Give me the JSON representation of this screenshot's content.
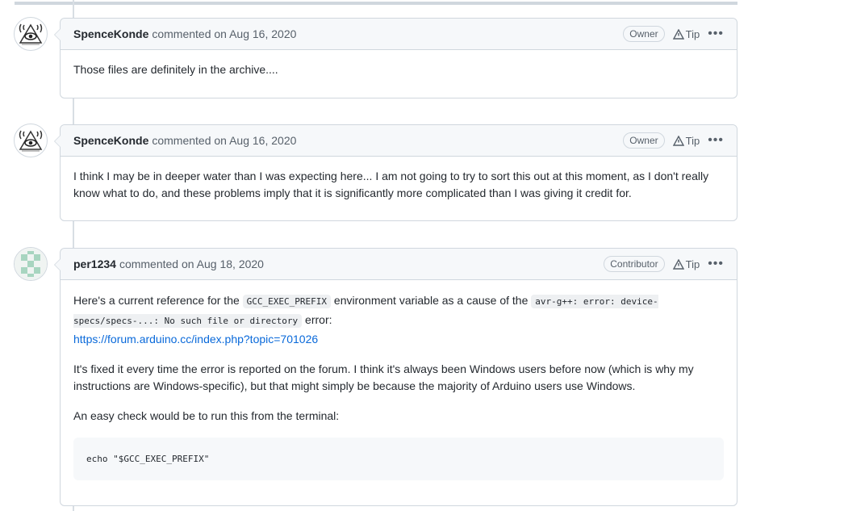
{
  "comments": [
    {
      "author": "SpenceKonde",
      "action": "commented on",
      "date": "Aug 16, 2020",
      "role": "Owner",
      "tip": "Tip",
      "more": "•••",
      "body": "Those files are definitely in the archive...."
    },
    {
      "author": "SpenceKonde",
      "action": "commented on",
      "date": "Aug 16, 2020",
      "role": "Owner",
      "tip": "Tip",
      "more": "•••",
      "body": "I think I may be in deeper water than I was expecting here... I am not going to try to sort this out at this moment, as I don't really know what to do, and these problems imply that it is significantly more complicated than I was giving it credit for."
    },
    {
      "author": "per1234",
      "action": "commented on",
      "date": "Aug 18, 2020",
      "role": "Contributor",
      "tip": "Tip",
      "more": "•••",
      "p1_text1": "Here's a current reference for the ",
      "p1_code1": "GCC_EXEC_PREFIX",
      "p1_text2": " environment variable as a cause of the ",
      "p1_code2": "avr-g++: error: device-specs/specs-...: No such file or directory",
      "p1_text3": " error:",
      "p1_link": "https://forum.arduino.cc/index.php?topic=701026",
      "p2": "It's fixed it every time the error is reported on the forum. I think it's always been Windows users before now (which is why my instructions are Windows-specific), but that might simply be because the majority of Arduino users use Windows.",
      "p3": "An easy check would be to run this from the terminal:",
      "code_block": "echo \"$GCC_EXEC_PREFIX\""
    }
  ],
  "colors": {
    "link": "#0969da",
    "border": "#d0d7de",
    "header_bg": "#f6f8fa"
  }
}
